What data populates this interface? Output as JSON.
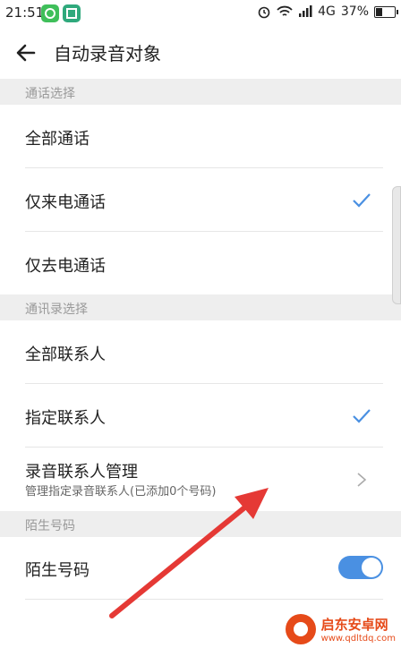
{
  "status_bar": {
    "time": "21:51",
    "network": "4G",
    "battery": "37%"
  },
  "header": {
    "title": "自动录音对象"
  },
  "sections": {
    "call_select": "通话选择",
    "contacts_select": "通讯录选择",
    "stranger": "陌生号码"
  },
  "call_options": {
    "all_calls": "全部通话",
    "incoming_only": "仅来电通话",
    "outgoing_only": "仅去电通话"
  },
  "contact_options": {
    "all_contacts": "全部联系人",
    "specified_contacts": "指定联系人",
    "manage_title": "录音联系人管理",
    "manage_subtitle": "管理指定录音联系人(已添加0个号码)"
  },
  "stranger_option": {
    "label": "陌生号码",
    "enabled": true
  },
  "watermark": {
    "name": "启东安卓网",
    "url": "www.qdltdq.com"
  },
  "colors": {
    "accent": "#4a90e2",
    "section_bg": "#eeeeee",
    "arrow": "#e53935"
  }
}
